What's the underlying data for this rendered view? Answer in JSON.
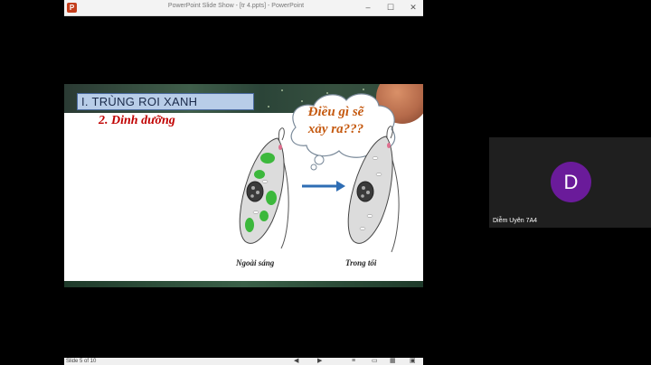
{
  "window": {
    "title": "PowerPoint Slide Show - [tr 4.ppts] - PowerPoint",
    "app_icon": "P",
    "minimize": "–",
    "maximize": "☐",
    "close": "✕"
  },
  "slide": {
    "title": "I. TRÙNG ROI XANH",
    "subtitle": "2. Dinh dưỡng",
    "bubble_line1": "Điều gì sẽ",
    "bubble_line2": "xảy ra???",
    "caption_left": "Ngoài sáng",
    "caption_right": "Trong tối"
  },
  "status": {
    "slide_counter": "Slide 5 of 10"
  },
  "participant": {
    "initial": "D",
    "name": "Diễm Uyên 7A4",
    "avatar_color": "#6a1b9a"
  },
  "colors": {
    "chloroplast": "#3cb83c",
    "arrow": "#2e6db4",
    "subtitle": "#c00000",
    "bubble_text": "#c55a11"
  }
}
